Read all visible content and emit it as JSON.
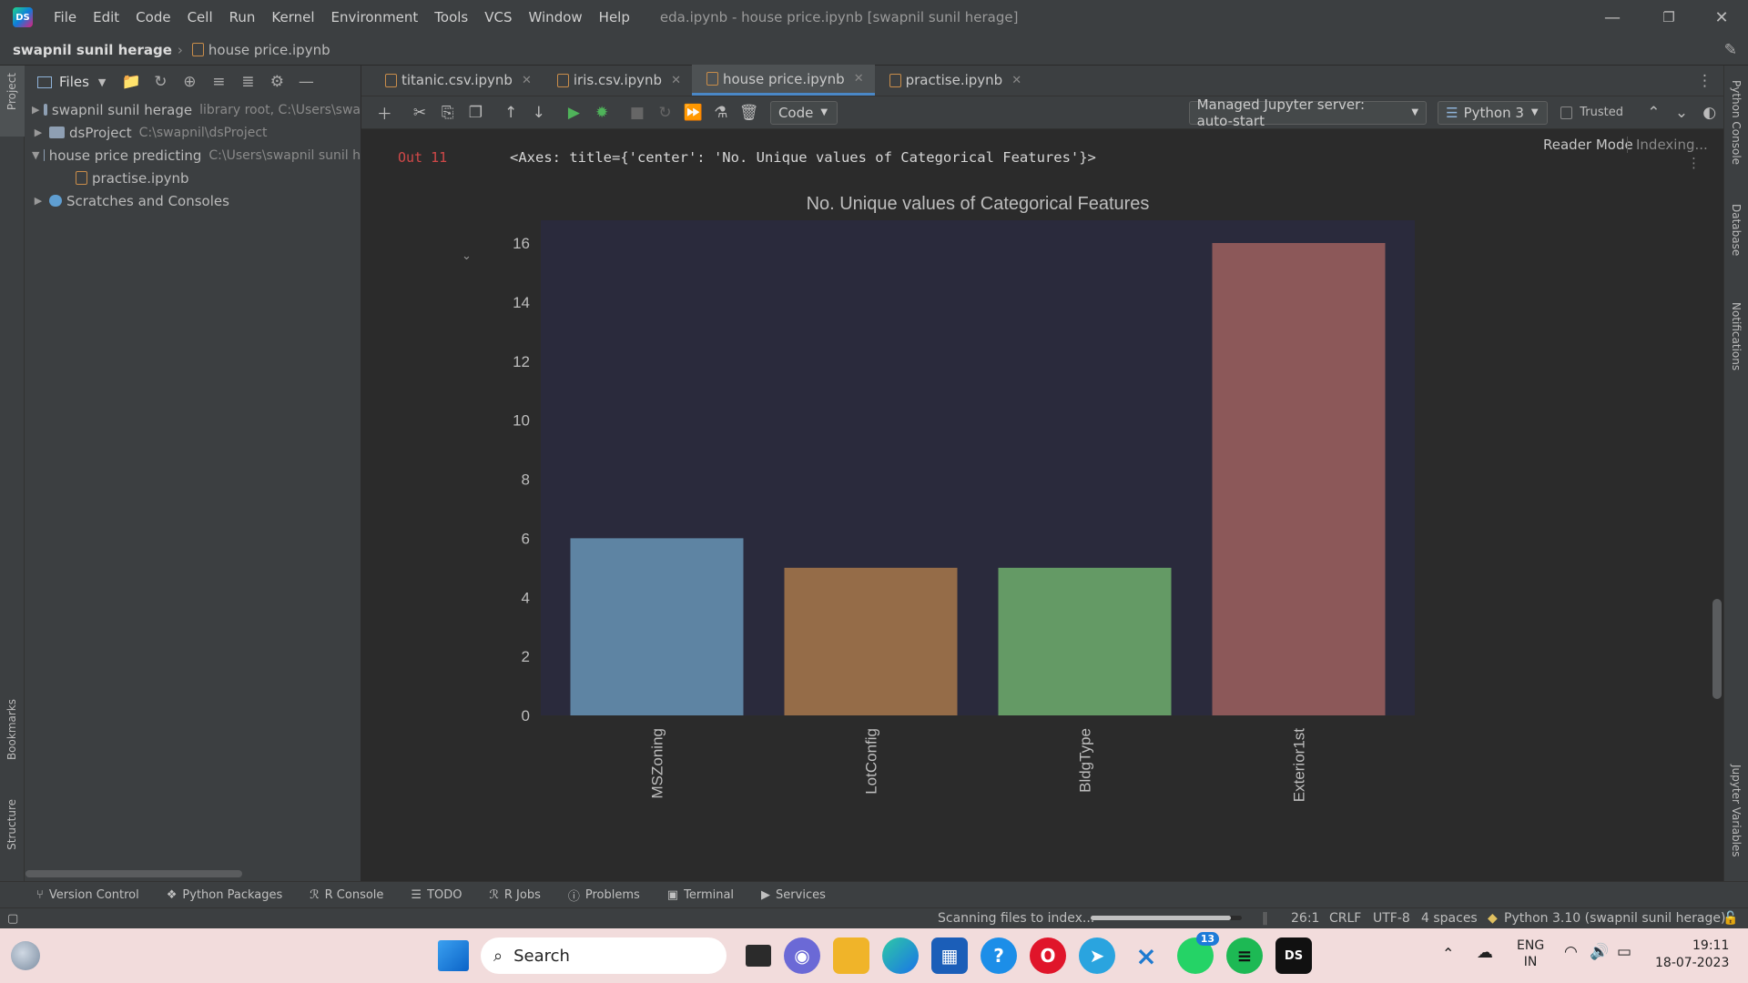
{
  "titlebar": {
    "menu": [
      "File",
      "Edit",
      "Code",
      "Cell",
      "Run",
      "Kernel",
      "Environment",
      "Tools",
      "VCS",
      "Window",
      "Help"
    ],
    "window_title": "eda.ipynb - house price.ipynb [swapnil sunil herage]"
  },
  "navbar": {
    "project": "swapnil sunil herage",
    "file": "house price.ipynb"
  },
  "leftstrip": {
    "project": "Project",
    "bookmarks": "Bookmarks",
    "structure": "Structure"
  },
  "rightstrip": {
    "python_console": "Python Console",
    "database": "Database",
    "notifications": "Notifications",
    "jupyter_variables": "Jupyter Variables"
  },
  "project_panel": {
    "view_label": "Files",
    "tree": [
      {
        "label": "swapnil sunil herage",
        "path": "library root, C:\\Users\\swa"
      },
      {
        "label": "dsProject",
        "path": "C:\\swapnil\\dsProject"
      },
      {
        "label": "house price predicting",
        "path": "C:\\Users\\swapnil sunil h"
      },
      {
        "label": "practise.ipynb",
        "path": ""
      },
      {
        "label": "Scratches and Consoles",
        "path": ""
      }
    ]
  },
  "tabs": [
    "titanic.csv.ipynb",
    "iris.csv.ipynb",
    "house price.ipynb",
    "practise.ipynb"
  ],
  "nb_toolbar": {
    "cell_type": "Code",
    "server": "Managed Jupyter server: auto-start",
    "kernel": "Python 3",
    "trusted": "Trusted"
  },
  "editor": {
    "reader_mode": "Reader Mode",
    "indexing": "Indexing..."
  },
  "output": {
    "label": "Out 11",
    "text": "<Axes: title={'center': 'No. Unique values of Categorical Features'}>"
  },
  "chart_data": {
    "type": "bar",
    "title": "No. Unique values of Categorical Features",
    "categories": [
      "MSZoning",
      "LotConfig",
      "BldgType",
      "Exterior1st"
    ],
    "values": [
      6,
      5,
      5,
      16
    ],
    "colors": [
      "#5e84a3",
      "#956c48",
      "#649a65",
      "#8c5859"
    ],
    "yticks": [
      0,
      2,
      4,
      6,
      8,
      10,
      12,
      14,
      16
    ],
    "ylim": [
      0,
      16
    ],
    "xlabel": "",
    "ylabel": "",
    "background": "#2a2a3c",
    "grid": false
  },
  "bottom_tools": [
    "Version Control",
    "Python Packages",
    "R Console",
    "TODO",
    "R Jobs",
    "Problems",
    "Terminal",
    "Services"
  ],
  "statusbar": {
    "scan": "Scanning files to index...",
    "position": "26:1",
    "line_sep": "CRLF",
    "encoding": "UTF-8",
    "indent": "4 spaces",
    "interpreter": "Python 3.10 (swapnil sunil herage)"
  },
  "taskbar": {
    "search": "Search",
    "whatsapp_badge": "13",
    "lang": "ENG",
    "region": "IN",
    "time": "19:11",
    "date": "18-07-2023"
  }
}
